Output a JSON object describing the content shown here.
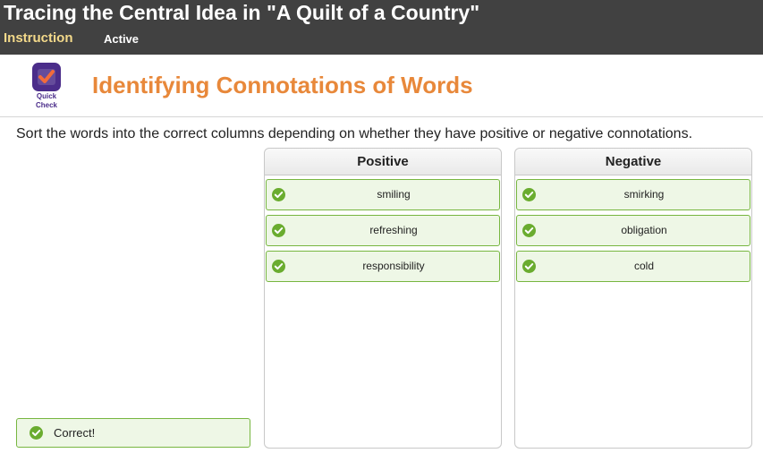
{
  "header": {
    "lesson_title": "Tracing the Central Idea in \"A Quilt of a Country\"",
    "tab_instruction": "Instruction",
    "tab_active": "Active"
  },
  "activity": {
    "logo_line1": "Quick",
    "logo_line2": "Check",
    "title": "Identifying Connotations of Words",
    "instructions": "Sort the words into the correct columns depending on whether they have positive or negative connotations."
  },
  "columns": {
    "positive": {
      "header": "Positive",
      "items": [
        "smiling",
        "refreshing",
        "responsibility"
      ]
    },
    "negative": {
      "header": "Negative",
      "items": [
        "smirking",
        "obligation",
        "cold"
      ]
    }
  },
  "feedback": {
    "message": "Correct!"
  },
  "colors": {
    "topbar": "#414141",
    "instruction_tab": "#f3d98a",
    "title_orange": "#e8883a",
    "logo_purple": "#4b2d8a",
    "correct_green": "#77b640",
    "correct_bg": "#eef7e6"
  },
  "icons": {
    "logo": "quick-check-icon",
    "item_status": "check-circle-icon"
  }
}
